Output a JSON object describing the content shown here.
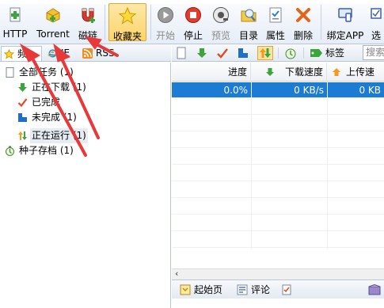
{
  "toolbar": {
    "buttons": [
      {
        "id": "http",
        "label": "HTTP",
        "icon": "plus-page-icon"
      },
      {
        "id": "torrent",
        "label": "Torrent",
        "icon": "plus-torrent-icon"
      },
      {
        "id": "magnet",
        "label": "磁链",
        "icon": "magnet-icon"
      },
      {
        "id": "favorites",
        "label": "收藏夹",
        "icon": "star-icon",
        "active": true
      },
      {
        "id": "start",
        "label": "开始",
        "icon": "play-icon",
        "disabled": true
      },
      {
        "id": "stop",
        "label": "停止",
        "icon": "stop-icon"
      },
      {
        "id": "preview",
        "label": "预览",
        "icon": "preview-icon",
        "disabled": true
      },
      {
        "id": "directory",
        "label": "目录",
        "icon": "folder-search-icon"
      },
      {
        "id": "properties",
        "label": "属性",
        "icon": "properties-icon"
      },
      {
        "id": "delete",
        "label": "删除",
        "icon": "delete-x-icon"
      },
      {
        "id": "bind_app",
        "label": "绑定APP",
        "icon": "bind-app-icon"
      },
      {
        "id": "select",
        "label": "选",
        "icon": "select-icon"
      }
    ]
  },
  "left_tabs": [
    {
      "label": "频",
      "icon": "star-icon",
      "selected": true
    },
    {
      "label": "IE",
      "icon": "ie-icon"
    },
    {
      "label": "RSS",
      "icon": "rss-icon"
    }
  ],
  "tree": [
    {
      "label": "全部任务 (1)",
      "icon": "page-icon",
      "level": 0
    },
    {
      "label": "正在下载 (1)",
      "icon": "down-arrow-icon",
      "level": 1
    },
    {
      "label": "已完成",
      "icon": "check-icon",
      "level": 1
    },
    {
      "label": "未完成 (1)",
      "icon": "incomplete-icon",
      "level": 1
    },
    {
      "label": "正在运行 (1)",
      "icon": "updown-arrow-icon",
      "level": 1,
      "selected": true
    },
    {
      "label": "种子存档 (1)",
      "icon": "archive-icon",
      "level": 0
    }
  ],
  "sub_toolbar": {
    "tag_label": "标签",
    "search_placeholder": "搜索"
  },
  "grid": {
    "columns": [
      "进度",
      "下载速度",
      "上传速"
    ],
    "rows": [
      {
        "progress": "0.0%",
        "download_speed": "0 KB/s",
        "upload_speed": "0 KB"
      }
    ]
  },
  "bottom_tabs": [
    {
      "label": "起始页",
      "icon": "home-page-icon"
    },
    {
      "label": "评论",
      "icon": "comment-icon"
    }
  ],
  "colors": {
    "selection": "#1c7bd3",
    "arrow": "#e8393a"
  }
}
